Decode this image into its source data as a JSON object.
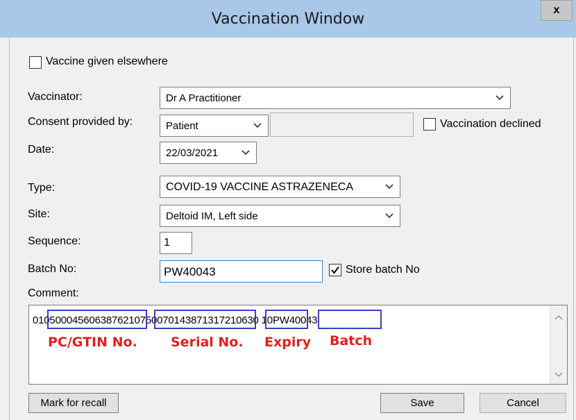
{
  "window": {
    "title": "Vaccination Window",
    "close_glyph": "x"
  },
  "elsewhere": {
    "label": "Vaccine given elsewhere",
    "checked": false
  },
  "vaccinator": {
    "label": "Vaccinator:",
    "value": "Dr A Practitioner"
  },
  "consent": {
    "label": "Consent provided by:",
    "value": "Patient",
    "extra_value": ""
  },
  "declined": {
    "label": "Vaccination declined",
    "checked": false
  },
  "date": {
    "label": "Date:",
    "value": "22/03/2021"
  },
  "type": {
    "label": "Type:",
    "value": "COVID-19 VACCINE ASTRAZENECA"
  },
  "site": {
    "label": "Site:",
    "value": "Deltoid IM, Left side"
  },
  "sequence": {
    "label": "Sequence:",
    "value": "1"
  },
  "batch": {
    "label": "Batch No:",
    "value": "PW40043",
    "store_label": "Store batch No",
    "store_checked": true
  },
  "comment": {
    "label": "Comment:",
    "text": "0105000456063876210750070143871317210630 10PW40043"
  },
  "annotations": {
    "gtin": "PC/GTIN No.",
    "serial": "Serial No.",
    "expiry": "Expiry",
    "batch": "Batch",
    "color": "#e0211e",
    "box_color": "#3a3fc0"
  },
  "buttons": {
    "recall": "Mark for recall",
    "save": "Save",
    "cancel": "Cancel"
  }
}
